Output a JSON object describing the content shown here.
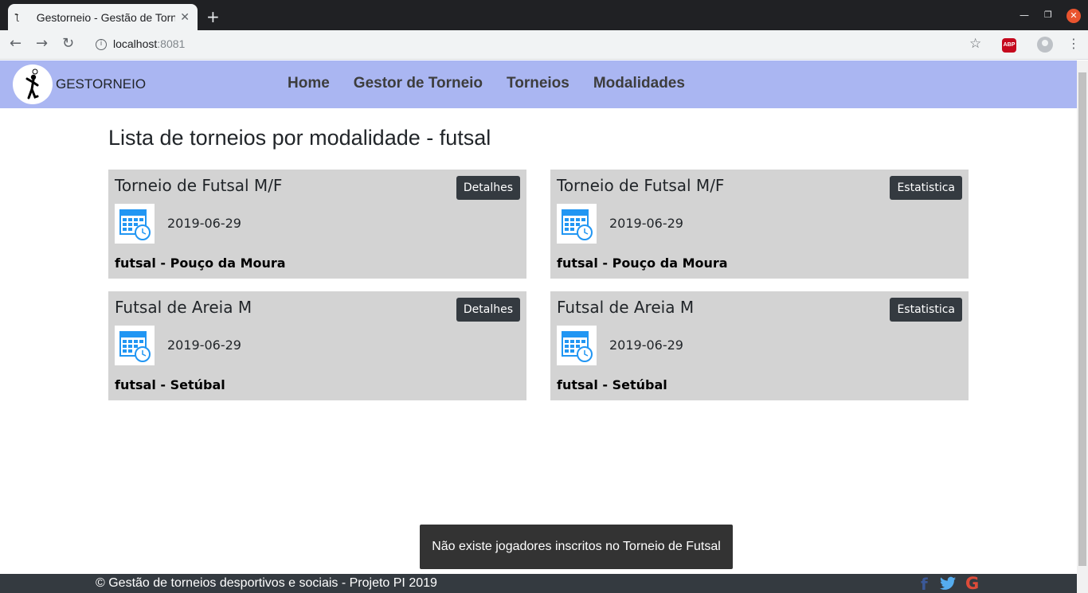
{
  "browser": {
    "tab_title": "Gestorneio - Gestão de Torneio",
    "favicon": "player-icon",
    "url_host": "localhost",
    "url_port": ":8081"
  },
  "navbar": {
    "brand": "GESTORNEIO",
    "links": [
      "Home",
      "Gestor de Torneio",
      "Torneios",
      "Modalidades"
    ],
    "background": "#aab6f2"
  },
  "page": {
    "title": "Lista de torneios por modalidade - futsal"
  },
  "cards": [
    {
      "title": "Torneio de Futsal M/F",
      "button": "Detalhes",
      "date": "2019-06-29",
      "location": "futsal - Pouço da Moura",
      "icon": "calendar-icon"
    },
    {
      "title": "Torneio de Futsal M/F",
      "button": "Estatistica",
      "date": "2019-06-29",
      "location": "futsal - Pouço da Moura",
      "icon": "calendar-icon"
    },
    {
      "title": "Futsal de Areia M",
      "button": "Detalhes",
      "date": "2019-06-29",
      "location": "futsal - Setúbal",
      "icon": "calendar-icon"
    },
    {
      "title": "Futsal de Areia M",
      "button": "Estatistica",
      "date": "2019-06-29",
      "location": "futsal - Setúbal",
      "icon": "calendar-icon"
    }
  ],
  "toast": {
    "message": "Não existe jogadores inscritos no Torneio de Futsal"
  },
  "footer": {
    "text": "© Gestão de torneios desportivos e sociais - Projeto PI 2019",
    "social": [
      "facebook-icon",
      "twitter-icon",
      "google-icon"
    ]
  }
}
